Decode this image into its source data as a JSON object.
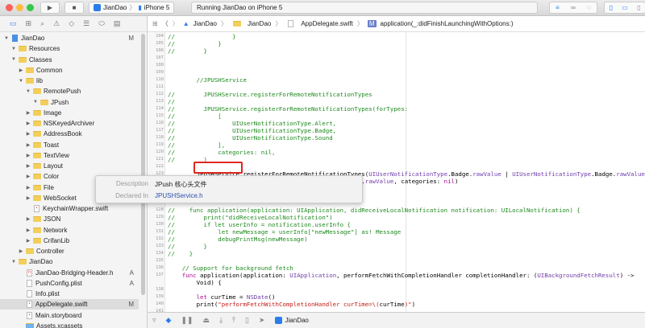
{
  "toolbar": {
    "scheme_project": "JianDao",
    "scheme_device": "iPhone 5",
    "status": "Running JianDao on iPhone 5",
    "run_icon": "play-icon",
    "stop_icon": "stop-icon"
  },
  "jumpbar": {
    "items": [
      "JianDao",
      "JianDao",
      "AppDelegate.swift",
      "application(_:didFinishLaunchingWithOptions:)"
    ]
  },
  "sidebar": {
    "items": [
      {
        "label": "JianDao",
        "indent": 0,
        "kind": "project",
        "disc": "▼",
        "badge": "M"
      },
      {
        "label": "Resources",
        "indent": 1,
        "kind": "folder",
        "disc": "▼"
      },
      {
        "label": "Classes",
        "indent": 1,
        "kind": "folder",
        "disc": "▼"
      },
      {
        "label": "Common",
        "indent": 2,
        "kind": "folder",
        "disc": "▶"
      },
      {
        "label": "lib",
        "indent": 2,
        "kind": "folder",
        "disc": "▼"
      },
      {
        "label": "RemotePush",
        "indent": 3,
        "kind": "folder",
        "disc": "▼"
      },
      {
        "label": "JPush",
        "indent": 4,
        "kind": "folder",
        "disc": "▼"
      },
      {
        "label": "Image",
        "indent": 3,
        "kind": "folder",
        "disc": "▶"
      },
      {
        "label": "NSKeyedArchiver",
        "indent": 3,
        "kind": "folder",
        "disc": "▶"
      },
      {
        "label": "AddressBook",
        "indent": 3,
        "kind": "folder",
        "disc": "▶"
      },
      {
        "label": "Toast",
        "indent": 3,
        "kind": "folder",
        "disc": "▶"
      },
      {
        "label": "TextView",
        "indent": 3,
        "kind": "folder",
        "disc": "▶"
      },
      {
        "label": "Layout",
        "indent": 3,
        "kind": "folder",
        "disc": "▶"
      },
      {
        "label": "Color",
        "indent": 3,
        "kind": "folder",
        "disc": "▶"
      },
      {
        "label": "File",
        "indent": 3,
        "kind": "folder",
        "disc": "▶"
      },
      {
        "label": "WebSocket",
        "indent": 3,
        "kind": "folder",
        "disc": "▶"
      },
      {
        "label": "KeychainWrapper.swift",
        "indent": 3,
        "kind": "swift",
        "disc": ""
      },
      {
        "label": "JSON",
        "indent": 3,
        "kind": "folder",
        "disc": "▶"
      },
      {
        "label": "Network",
        "indent": 3,
        "kind": "folder",
        "disc": "▶"
      },
      {
        "label": "CrifanLib",
        "indent": 3,
        "kind": "folder",
        "disc": "▶"
      },
      {
        "label": "Controller",
        "indent": 2,
        "kind": "folder",
        "disc": "▶"
      },
      {
        "label": "JianDao",
        "indent": 1,
        "kind": "folder",
        "disc": "▼"
      },
      {
        "label": "JianDao-Bridging-Header.h",
        "indent": 2,
        "kind": "h",
        "disc": "",
        "badge": "A"
      },
      {
        "label": "PushConfig.plist",
        "indent": 2,
        "kind": "plist",
        "disc": "",
        "badge": "A"
      },
      {
        "label": "Info.plist",
        "indent": 2,
        "kind": "plist",
        "disc": ""
      },
      {
        "label": "AppDelegate.swift",
        "indent": 2,
        "kind": "swift",
        "disc": "",
        "badge": "M",
        "selected": true
      },
      {
        "label": "Main.storyboard",
        "indent": 2,
        "kind": "storyboard",
        "disc": ""
      },
      {
        "label": "Assets.xcassets",
        "indent": 2,
        "kind": "assets",
        "disc": ""
      }
    ]
  },
  "code": [
    {
      "n": "104",
      "segs": [
        [
          "c",
          "//                }"
        ]
      ]
    },
    {
      "n": "105",
      "segs": [
        [
          "c",
          "//            }"
        ]
      ]
    },
    {
      "n": "106",
      "segs": [
        [
          "c",
          "//        }"
        ]
      ]
    },
    {
      "n": "107",
      "segs": []
    },
    {
      "n": "108",
      "segs": []
    },
    {
      "n": "109",
      "segs": []
    },
    {
      "n": "110",
      "segs": [
        [
          "c",
          "        //JPUSHService"
        ]
      ]
    },
    {
      "n": "111",
      "segs": []
    },
    {
      "n": "112",
      "segs": [
        [
          "c",
          "//        JPUSHService.registerForRemoteNotificationTypes"
        ]
      ]
    },
    {
      "n": "113",
      "segs": [
        [
          "c",
          "//"
        ]
      ]
    },
    {
      "n": "114",
      "segs": [
        [
          "c",
          "//        JPUSHService.registerForRemoteNotificationTypes(forTypes:"
        ]
      ]
    },
    {
      "n": "115",
      "segs": [
        [
          "c",
          "//            ["
        ]
      ]
    },
    {
      "n": "116",
      "segs": [
        [
          "c",
          "//                UIUserNotificationType.Alert,"
        ]
      ]
    },
    {
      "n": "117",
      "segs": [
        [
          "c",
          "//                UIUserNotificationType.Badge,"
        ]
      ]
    },
    {
      "n": "118",
      "segs": [
        [
          "c",
          "//                UIUserNotificationType.Sound"
        ]
      ]
    },
    {
      "n": "119",
      "segs": [
        [
          "c",
          "//            ],"
        ]
      ]
    },
    {
      "n": "120",
      "segs": [
        [
          "c",
          "//            categories: nil,"
        ]
      ]
    },
    {
      "n": "121",
      "segs": [
        [
          "c",
          "//        )"
        ]
      ]
    },
    {
      "n": "122",
      "segs": []
    },
    {
      "n": "123",
      "segs": [
        [
          "p",
          "        JPUSHService.registerForRemoteNotificationTypes("
        ],
        [
          "t",
          "UIUserNotificationType"
        ],
        [
          "p",
          "."
        ],
        [
          "p",
          "Badge"
        ],
        [
          "p",
          "."
        ],
        [
          "t",
          "rawValue"
        ],
        [
          "p",
          " | "
        ],
        [
          "t",
          "UIUserNotificationType"
        ],
        [
          "p",
          ".Badge."
        ],
        [
          "t",
          "rawValue"
        ]
      ]
    },
    {
      "n": "124",
      "segs": [
        [
          "p",
          "                        "
        ],
        [
          "p",
          "| "
        ],
        [
          "t",
          "UIUserNotificationType"
        ],
        [
          "p",
          ".Alert."
        ],
        [
          "t",
          "rawValue"
        ],
        [
          "p",
          ", categories: "
        ],
        [
          "k",
          "nil"
        ],
        [
          "p",
          ")"
        ]
      ]
    },
    {
      "n": "125",
      "segs": []
    },
    {
      "n": "126",
      "segs": []
    },
    {
      "n": "127",
      "segs": []
    },
    {
      "n": "128",
      "segs": [
        [
          "c",
          "//    func application(application: UIApplication, didReceiveLocalNotification notification: UILocalNotification) {"
        ]
      ]
    },
    {
      "n": "129",
      "segs": [
        [
          "c",
          "//        print(\"didReceiveLocalNotification\")"
        ]
      ]
    },
    {
      "n": "130",
      "segs": [
        [
          "c",
          "//        if let userInfo = notification.userInfo {"
        ]
      ]
    },
    {
      "n": "131",
      "segs": [
        [
          "c",
          "//            let newMessage = userInfo[\"newMessage\"] as! Message"
        ]
      ]
    },
    {
      "n": "132",
      "segs": [
        [
          "c",
          "//            debugPrintMsg(newMessage)"
        ]
      ]
    },
    {
      "n": "133",
      "segs": [
        [
          "c",
          "//        }"
        ]
      ]
    },
    {
      "n": "134",
      "segs": [
        [
          "c",
          "//    }"
        ]
      ]
    },
    {
      "n": "135",
      "segs": []
    },
    {
      "n": "136",
      "segs": [
        [
          "c",
          "    // Support for background fetch"
        ]
      ]
    },
    {
      "n": "137",
      "segs": [
        [
          "k",
          "    func "
        ],
        [
          "p",
          "application(application: "
        ],
        [
          "t",
          "UIApplication"
        ],
        [
          "p",
          ", performFetchWithCompletionHandler completionHandler: ("
        ],
        [
          "t",
          "UIBackgroundFetchResult"
        ],
        [
          "p",
          ") ->"
        ]
      ]
    },
    {
      "n": "",
      "segs": [
        [
          "p",
          "        Void) {"
        ]
      ]
    },
    {
      "n": "138",
      "segs": []
    },
    {
      "n": "139",
      "segs": [
        [
          "k",
          "        let "
        ],
        [
          "p",
          "curTime = "
        ],
        [
          "t",
          "NSDate"
        ],
        [
          "p",
          "()"
        ]
      ]
    },
    {
      "n": "140",
      "segs": [
        [
          "p",
          "        print("
        ],
        [
          "s",
          "\"performFetchWithCompletionHandler curTime=\\("
        ],
        [
          "p",
          "curTime"
        ],
        [
          "s",
          ")\""
        ],
        [
          "p",
          ")"
        ]
      ]
    },
    {
      "n": "141",
      "segs": []
    }
  ],
  "popover": {
    "description_label": "Description",
    "description_value": "JPush 核心头文件",
    "declared_label": "Declared In",
    "declared_value": "JPUSHService.h"
  },
  "debugbar": {
    "target": "JianDao"
  },
  "colors": {
    "comment": "#1e8a1e",
    "keyword": "#aa0d91",
    "type": "#703daa",
    "string": "#c41a16",
    "highlight": "#e0281e"
  }
}
